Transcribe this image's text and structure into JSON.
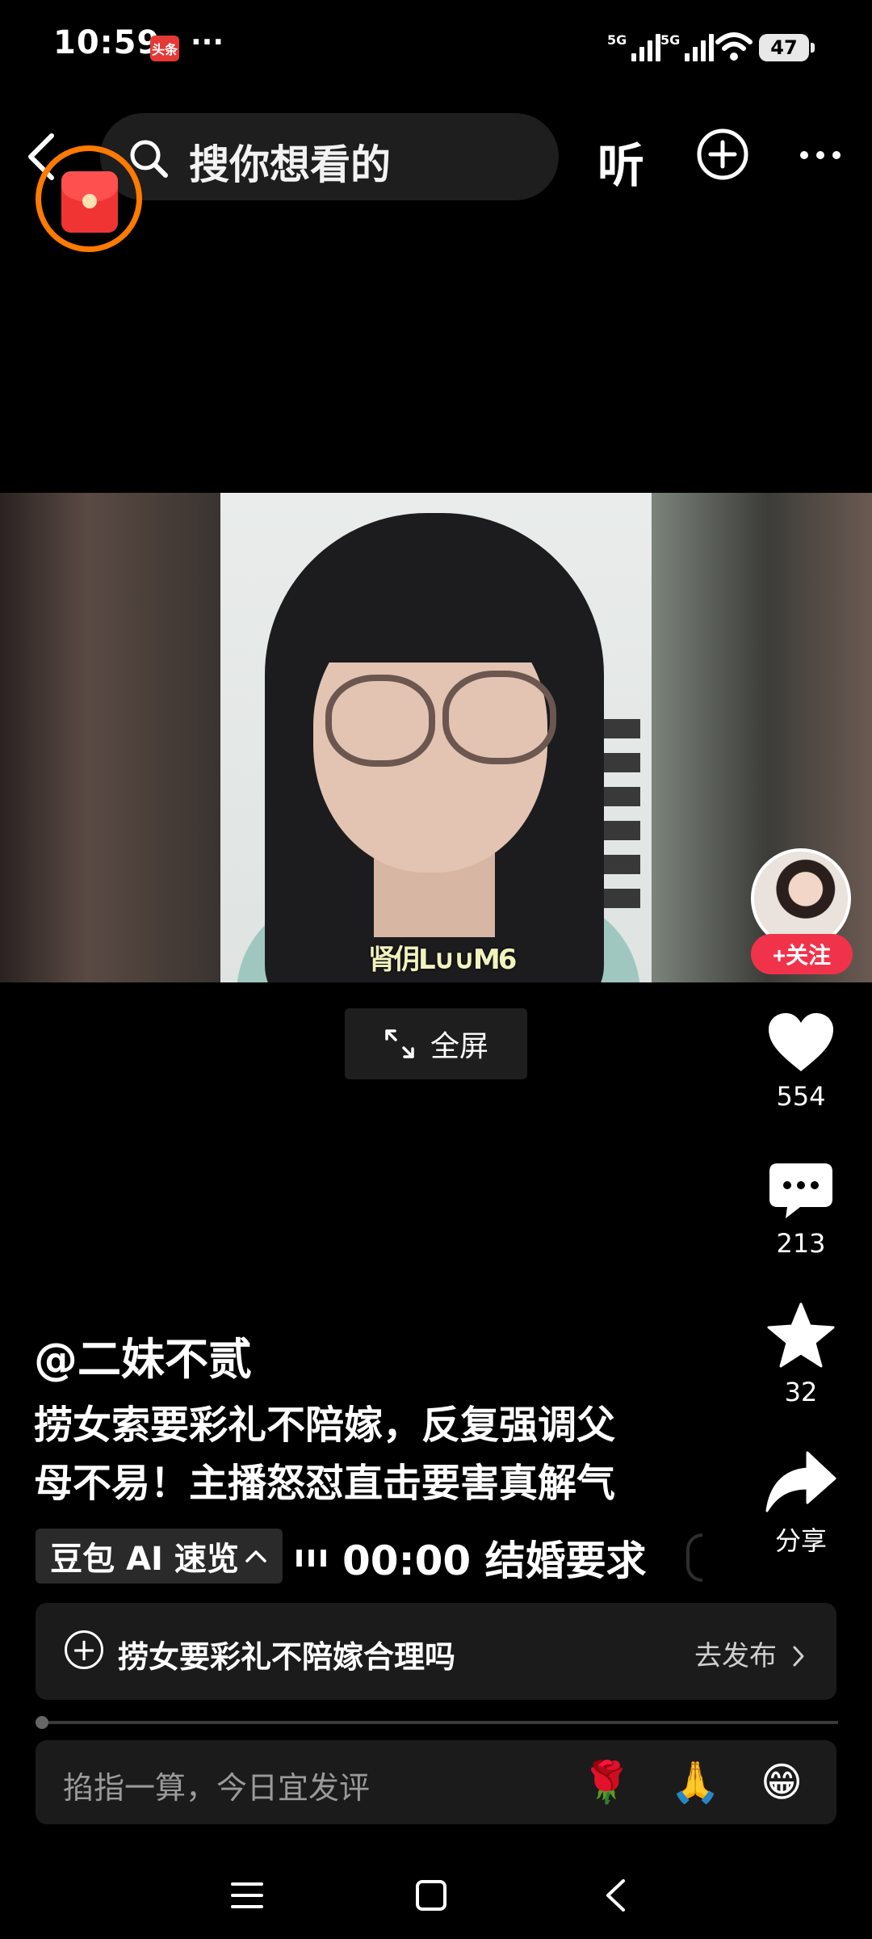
{
  "status_bar": {
    "time": "10:59",
    "news_badge": "头条",
    "more": "···",
    "sig1": "5G",
    "sig2": "5G",
    "battery": "47"
  },
  "header": {
    "search_placeholder": "搜你想看的",
    "listen_label": "听"
  },
  "video": {
    "caption_overlay": "肾仴L∪∪M6",
    "fullscreen_label": "全屏"
  },
  "sidebar": {
    "follow_label": "+关注",
    "likes": "554",
    "comments": "213",
    "favorites": "32",
    "share_label": "分享"
  },
  "post": {
    "author": "@二妹不贰",
    "description_line1": "捞女索要彩礼不陪嫁，反复强调父",
    "description_line2": "母不易！主播怒怼直击要害真解气",
    "doubao_label": "豆包 AI 速览",
    "ticker_bars": "ııı",
    "ticker_text": "00:00 结婚要求"
  },
  "topic": {
    "text": "捞女要彩礼不陪嫁合理吗",
    "publish_label": "去发布"
  },
  "playback": {
    "progress": 0.01
  },
  "comment": {
    "placeholder": "掐指一算，今日宜发评",
    "emojis": [
      "🌹",
      "🙏",
      "😁"
    ]
  },
  "icons": {
    "back": "back-icon",
    "search": "search-icon",
    "add": "plus-circle-icon",
    "more": "more-icon",
    "like": "heart-icon",
    "comment": "comment-icon",
    "favorite": "star-icon",
    "share": "share-icon",
    "expand": "expand-icon"
  },
  "colors": {
    "background": "#000000",
    "follow": "#f0334a",
    "redpacket_ring": "#ff7a00",
    "redpacket": "#f03434"
  }
}
